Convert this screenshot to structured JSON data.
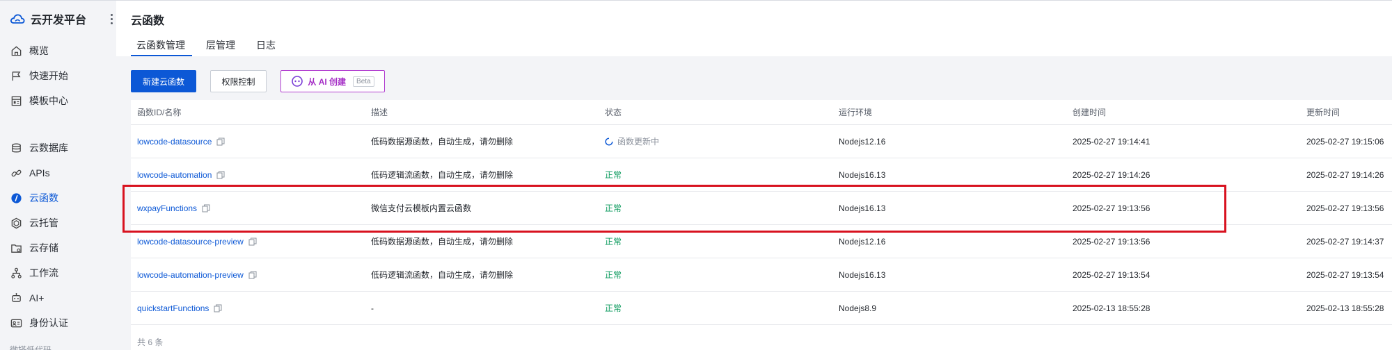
{
  "app": {
    "title": "云开发平台"
  },
  "sidebar": {
    "items": [
      {
        "label": "概览",
        "icon": "home-icon"
      },
      {
        "label": "快速开始",
        "icon": "flag-icon"
      },
      {
        "label": "模板中心",
        "icon": "template-icon"
      },
      {
        "label": "云数据库",
        "icon": "database-icon"
      },
      {
        "label": "APIs",
        "icon": "api-link-icon"
      },
      {
        "label": "云函数",
        "icon": "function-icon",
        "active": true
      },
      {
        "label": "云托管",
        "icon": "hexagon-icon"
      },
      {
        "label": "云存储",
        "icon": "folder-icon"
      },
      {
        "label": "工作流",
        "icon": "workflow-icon"
      },
      {
        "label": "AI+",
        "icon": "robot-icon"
      },
      {
        "label": "身份认证",
        "icon": "id-card-icon"
      }
    ],
    "group_label": "微搭低代码"
  },
  "header": {
    "title": "云函数",
    "tabs": [
      {
        "label": "云函数管理",
        "active": true
      },
      {
        "label": "层管理"
      },
      {
        "label": "日志"
      }
    ]
  },
  "toolbar": {
    "new_function_label": "新建云函数",
    "permission_label": "权限控制",
    "ai_create_label": "从 AI 创建",
    "ai_badge": "Beta"
  },
  "table": {
    "columns": [
      "函数ID/名称",
      "描述",
      "状态",
      "运行环境",
      "创建时间",
      "更新时间"
    ],
    "rows": [
      {
        "name": "lowcode-datasource",
        "desc": "低码数据源函数，自动生成，请勿删除",
        "status": "函数更新中",
        "status_type": "updating",
        "runtime": "Nodejs12.16",
        "created": "2025-02-27 19:14:41",
        "updated": "2025-02-27 19:15:06"
      },
      {
        "name": "lowcode-automation",
        "desc": "低码逻辑流函数，自动生成，请勿删除",
        "status": "正常",
        "status_type": "ok",
        "runtime": "Nodejs16.13",
        "created": "2025-02-27 19:14:26",
        "updated": "2025-02-27 19:14:26"
      },
      {
        "name": "wxpayFunctions",
        "desc": "微信支付云模板内置云函数",
        "status": "正常",
        "status_type": "ok",
        "runtime": "Nodejs16.13",
        "created": "2025-02-27 19:13:56",
        "updated": "2025-02-27 19:13:56"
      },
      {
        "name": "lowcode-datasource-preview",
        "desc": "低码数据源函数，自动生成，请勿删除",
        "status": "正常",
        "status_type": "ok",
        "runtime": "Nodejs12.16",
        "created": "2025-02-27 19:13:56",
        "updated": "2025-02-27 19:14:37"
      },
      {
        "name": "lowcode-automation-preview",
        "desc": "低码逻辑流函数，自动生成，请勿删除",
        "status": "正常",
        "status_type": "ok",
        "runtime": "Nodejs16.13",
        "created": "2025-02-27 19:13:54",
        "updated": "2025-02-27 19:13:54"
      },
      {
        "name": "quickstartFunctions",
        "desc": "-",
        "status": "正常",
        "status_type": "ok",
        "runtime": "Nodejs8.9",
        "created": "2025-02-13 18:55:28",
        "updated": "2025-02-13 18:55:28"
      }
    ],
    "total": "共 6 条"
  },
  "colors": {
    "brand": "#0c58d6",
    "ok": "#0a9a5c",
    "highlight": "#d8121f",
    "ai_accent": "#a52fc6"
  }
}
